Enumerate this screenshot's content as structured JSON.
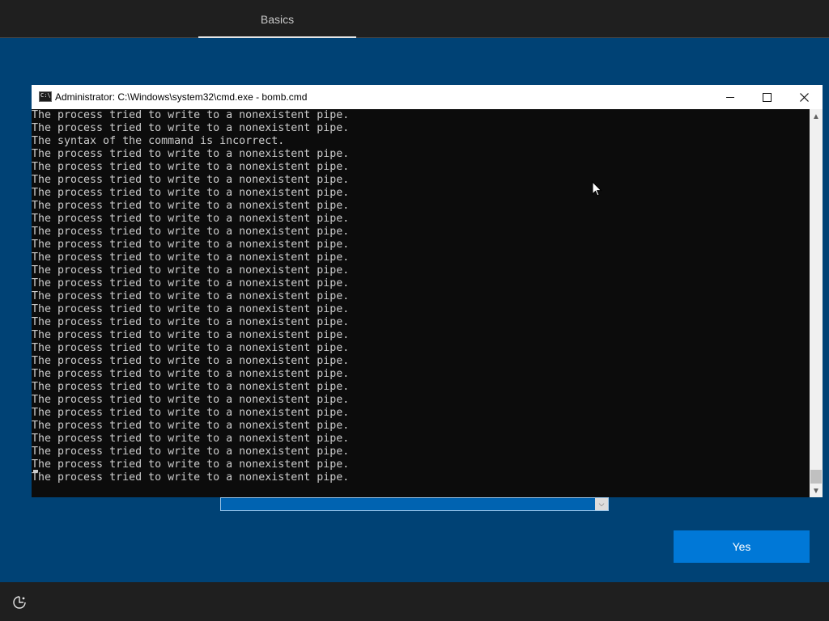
{
  "header": {
    "tab_label": "Basics"
  },
  "console_window": {
    "title": "Administrator: C:\\Windows\\system32\\cmd.exe - bomb.cmd",
    "icon_text": "C:\\",
    "lines": [
      "The process tried to write to a nonexistent pipe.",
      "The process tried to write to a nonexistent pipe.",
      "The syntax of the command is incorrect.",
      "The process tried to write to a nonexistent pipe.",
      "The process tried to write to a nonexistent pipe.",
      "The process tried to write to a nonexistent pipe.",
      "The process tried to write to a nonexistent pipe.",
      "The process tried to write to a nonexistent pipe.",
      "The process tried to write to a nonexistent pipe.",
      "The process tried to write to a nonexistent pipe.",
      "The process tried to write to a nonexistent pipe.",
      "The process tried to write to a nonexistent pipe.",
      "The process tried to write to a nonexistent pipe.",
      "The process tried to write to a nonexistent pipe.",
      "The process tried to write to a nonexistent pipe.",
      "The process tried to write to a nonexistent pipe.",
      "The process tried to write to a nonexistent pipe.",
      "The process tried to write to a nonexistent pipe.",
      "The process tried to write to a nonexistent pipe.",
      "The process tried to write to a nonexistent pipe.",
      "The process tried to write to a nonexistent pipe.",
      "The process tried to write to a nonexistent pipe.",
      "The process tried to write to a nonexistent pipe.",
      "The process tried to write to a nonexistent pipe.",
      "The process tried to write to a nonexistent pipe.",
      "The process tried to write to a nonexistent pipe.",
      "The process tried to write to a nonexistent pipe.",
      "The process tried to write to a nonexistent pipe.",
      "The process tried to write to a nonexistent pipe."
    ]
  },
  "dropdown": {
    "selected_value": ""
  },
  "actions": {
    "yes_label": "Yes"
  },
  "colors": {
    "background": "#004275",
    "bar": "#1f1f1f",
    "accent": "#0078d7",
    "console_bg": "#0c0c0c",
    "console_text": "#cccccc"
  },
  "icons": {
    "window_app": "cmd-icon",
    "minimize": "minimize-icon",
    "maximize": "maximize-icon",
    "close": "close-icon",
    "accessibility": "ease-of-access-icon"
  }
}
